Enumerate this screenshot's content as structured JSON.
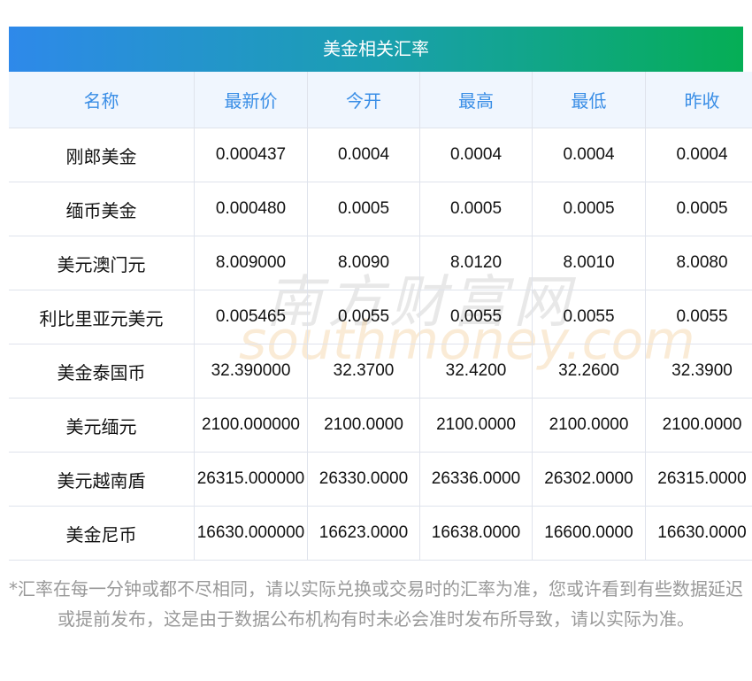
{
  "title": "美金相关汇率",
  "headers": [
    "名称",
    "最新价",
    "今开",
    "最高",
    "最低",
    "昨收"
  ],
  "rows": [
    [
      "刚郎美金",
      "0.000437",
      "0.0004",
      "0.0004",
      "0.0004",
      "0.0004"
    ],
    [
      "缅币美金",
      "0.000480",
      "0.0005",
      "0.0005",
      "0.0005",
      "0.0005"
    ],
    [
      "美元澳门元",
      "8.009000",
      "8.0090",
      "8.0120",
      "8.0010",
      "8.0080"
    ],
    [
      "利比里亚元美元",
      "0.005465",
      "0.0055",
      "0.0055",
      "0.0055",
      "0.0055"
    ],
    [
      "美金泰国币",
      "32.390000",
      "32.3700",
      "32.4200",
      "32.2600",
      "32.3900"
    ],
    [
      "美元缅元",
      "2100.000000",
      "2100.0000",
      "2100.0000",
      "2100.0000",
      "2100.0000"
    ],
    [
      "美元越南盾",
      "26315.000000",
      "26330.0000",
      "26336.0000",
      "26302.0000",
      "26315.0000"
    ],
    [
      "美金尼币",
      "16630.000000",
      "16623.0000",
      "16638.0000",
      "16600.0000",
      "16630.0000"
    ]
  ],
  "note": "*汇率在每一分钟或都不尽相同，请以实际兑换或交易时的汇率为准，您或许看到有些数据延迟或提前发布，这是由于数据公布机构有时未必会准时发布所导致，请以实际为准。",
  "watermark": {
    "cn": "南方财富网",
    "en": "southmoney.com"
  }
}
